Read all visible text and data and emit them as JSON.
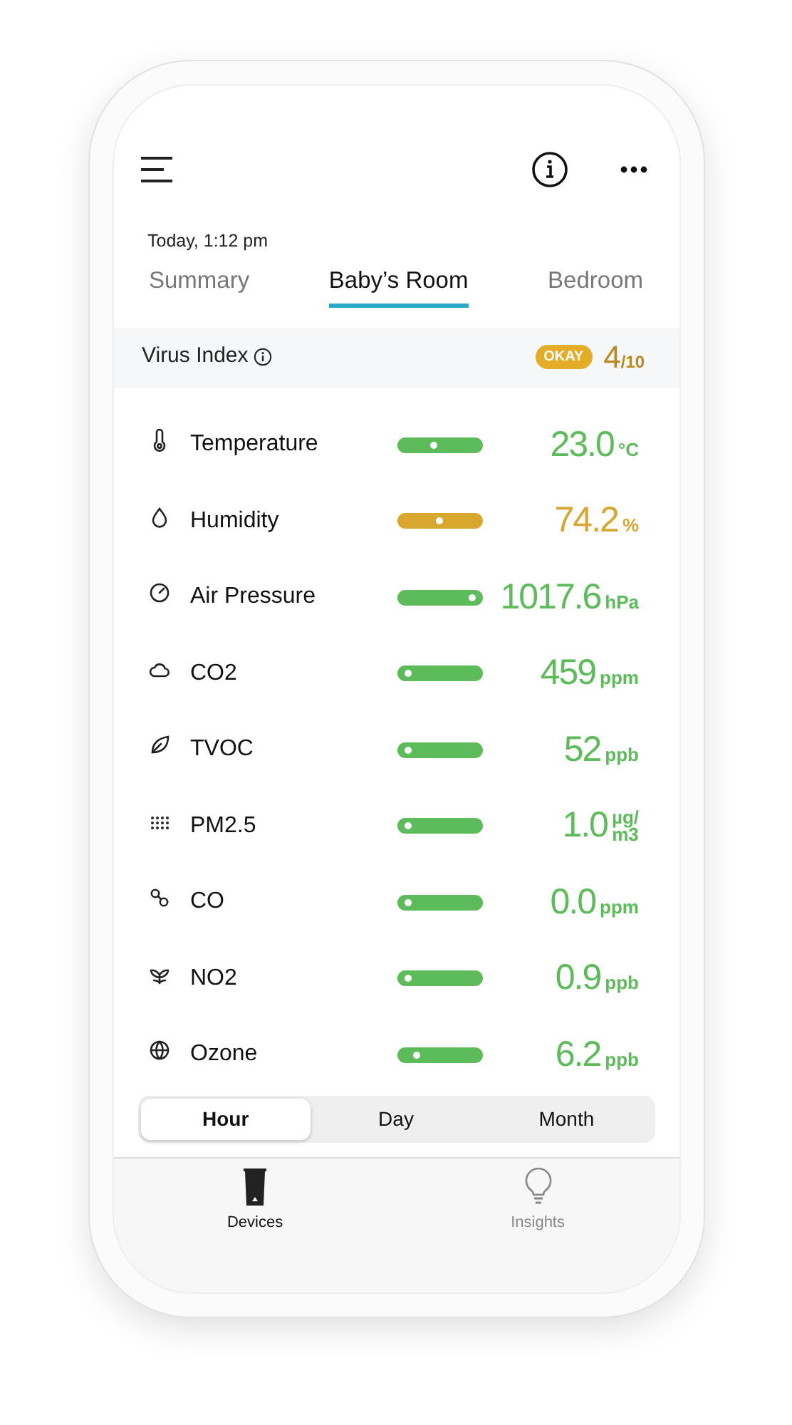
{
  "header": {
    "timestamp": "Today, 1:12 pm"
  },
  "tabs": [
    {
      "label": "Summary",
      "selected": false
    },
    {
      "label": "Baby’s Room",
      "selected": true
    },
    {
      "label": "Bedroom",
      "selected": false
    }
  ],
  "virus_index": {
    "label": "Virus Index",
    "badge": "OKAY",
    "score": "4",
    "scale": "/10"
  },
  "readings": [
    {
      "kind": "thermometer",
      "name": "Temperature",
      "color": "#5cbc59",
      "level": 0.42,
      "value": "23.0",
      "unit": "°C"
    },
    {
      "kind": "drop",
      "name": "Humidity",
      "color": "#d9a62e",
      "level": 0.5,
      "value": "74.2",
      "unit": "%"
    },
    {
      "kind": "gauge",
      "name": "Air Pressure",
      "color": "#5cbc59",
      "level": 0.92,
      "value": "1017.6",
      "unit": "hPa"
    },
    {
      "kind": "cloud",
      "name": "CO2",
      "color": "#5cbc59",
      "level": 0.1,
      "value": "459",
      "unit": "ppm"
    },
    {
      "kind": "leaf",
      "name": "TVOC",
      "color": "#5cbc59",
      "level": 0.1,
      "value": "52",
      "unit": "ppb"
    },
    {
      "kind": "dots",
      "name": "PM2.5",
      "color": "#5cbc59",
      "level": 0.1,
      "value": "1.0",
      "unit": "µg/",
      "unit_lower": "m3"
    },
    {
      "kind": "molecule",
      "name": "CO",
      "color": "#5cbc59",
      "level": 0.1,
      "value": "0.0",
      "unit": "ppm"
    },
    {
      "kind": "sprout",
      "name": "NO2",
      "color": "#5cbc59",
      "level": 0.1,
      "value": "0.9",
      "unit": "ppb"
    },
    {
      "kind": "globe",
      "name": "Ozone",
      "color": "#5cbc59",
      "level": 0.2,
      "value": "6.2",
      "unit": "ppb"
    }
  ],
  "range": [
    {
      "label": "Hour",
      "selected": true
    },
    {
      "label": "Day",
      "selected": false
    },
    {
      "label": "Month",
      "selected": false
    }
  ],
  "tab_bar": [
    {
      "kind": "device",
      "label": "Devices",
      "selected": true
    },
    {
      "kind": "bulb",
      "label": "Insights",
      "selected": false
    }
  ]
}
